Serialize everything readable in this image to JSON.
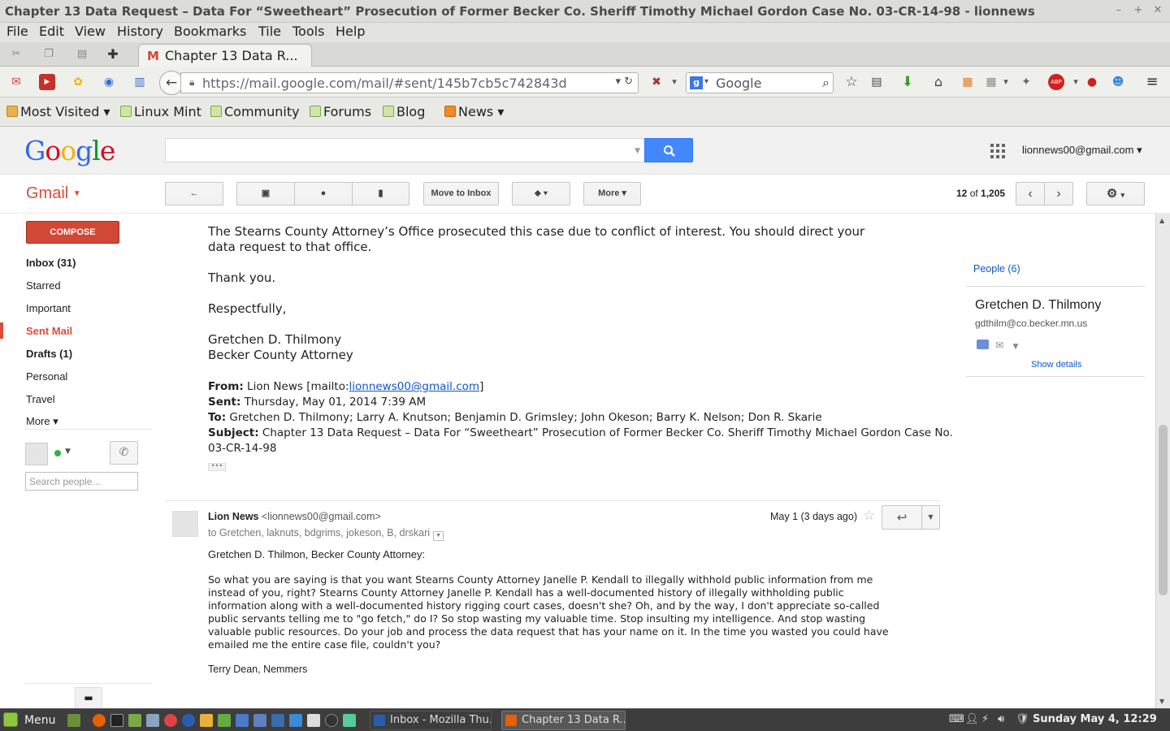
{
  "window": {
    "title": "Chapter 13 Data Request – Data For “Sweetheart” Prosecution of Former Becker Co. Sheriff Timothy Michael Gordon Case No. 03-CR-14-98 - lionnews",
    "min": "–",
    "max": "+",
    "close": "✕"
  },
  "menu": [
    "File",
    "Edit",
    "View",
    "History",
    "Bookmarks",
    "Tile",
    "Tools",
    "Help"
  ],
  "tab": {
    "label": "Chapter 13 Data R...",
    "favicon": "M"
  },
  "nav": {
    "url_host": "https://mail.google.com",
    "url_path": "/mail/#sent/145b7cb5c742843d",
    "search_placeholder": "Google"
  },
  "bookmarks": [
    "Most Visited ▾",
    "Linux Mint",
    "Community",
    "Forums",
    "Blog",
    "News ▾"
  ],
  "google": {
    "logo": [
      "G",
      "o",
      "o",
      "g",
      "l",
      "e"
    ],
    "logo_colors": [
      "#3369e8",
      "#d50f25",
      "#eeb211",
      "#3369e8",
      "#009925",
      "#d50f25"
    ],
    "account": "lionnews00@gmail.com ▾"
  },
  "gmail": {
    "label": "Gmail",
    "move_to_inbox": "Move to Inbox",
    "more": "More ▾",
    "counter_pre": "12",
    "counter_mid": " of ",
    "counter_post": "1,205",
    "accent": "#dd4b39"
  },
  "leftnav": {
    "compose": "COMPOSE",
    "items": [
      "Inbox (31)",
      "Starred",
      "Important",
      "Sent Mail",
      "Drafts (1)",
      "Personal",
      "Travel",
      "More ▾"
    ],
    "search_people": "Search people..."
  },
  "quoted": {
    "line1": "The Stearns County Attorney’s Office prosecuted this case due to conflict of interest.  You should direct your",
    "line2": "data request to that office.",
    "thanks": "Thank you.",
    "respect": "Respectfully,",
    "sig1": "Gretchen D. Thilmony",
    "sig2": "Becker County Attorney",
    "from_label": "From:",
    "from_val": " Lion News [mailto:",
    "from_link": "lionnews00@gmail.com",
    "from_end": "]",
    "sent_label": "Sent:",
    "sent_val": " Thursday, May 01, 2014 7:39 AM",
    "to_label": "To:",
    "to_val": " Gretchen D. Thilmony; Larry A. Knutson; Benjamin D. Grimsley; John Okeson; Barry K. Nelson; Don R. Skarie",
    "subj_label": "Subject:",
    "subj_val": " Chapter 13 Data Request – Data For “Sweetheart” Prosecution of Former Becker Co. Sheriff Timothy Michael Gordon Case No.",
    "subj_val2": "03-CR-14-98",
    "ellipsis": "•••"
  },
  "message": {
    "sender_name": "Lion News",
    "sender_email": " <lionnews00@gmail.com>",
    "to_line": "to Gretchen, laknuts, bdgrims, jokeson, B, drskari",
    "date": "May 1 (3 days ago)",
    "greeting": "Gretchen D. Thilmon, Becker County Attorney:",
    "body": [
      "So what you are saying is that you want Stearns County Attorney Janelle P. Kendall to illegally withhold public information from me",
      "instead of you, right? Stearns County Attorney Janelle P. Kendall has a well-documented history of illegally withholding public",
      "information along with a well-documented history rigging court cases, doesn't she? Oh, and by the way, I don't appreciate so-called",
      "public servants telling me to \"go fetch,\" do I? So stop wasting my valuable time. Stop insulting my intelligence. And stop wasting",
      "valuable public resources. Do your job and process the data request that has your name on it. In the time you wasted you could have",
      "emailed me the entire case file, couldn't you?"
    ],
    "signature": "Terry Dean, Nemmers"
  },
  "people": {
    "header": "People (6)",
    "name": "Gretchen D. Thilmony",
    "email": "gdthilm@co.becker.mn.us",
    "show_details": "Show details"
  },
  "taskbar": {
    "menu": "Menu",
    "task1": "Inbox - Mozilla Thu...",
    "task2": "Chapter 13 Data R...",
    "clock": "Sunday May  4, 12:29"
  }
}
